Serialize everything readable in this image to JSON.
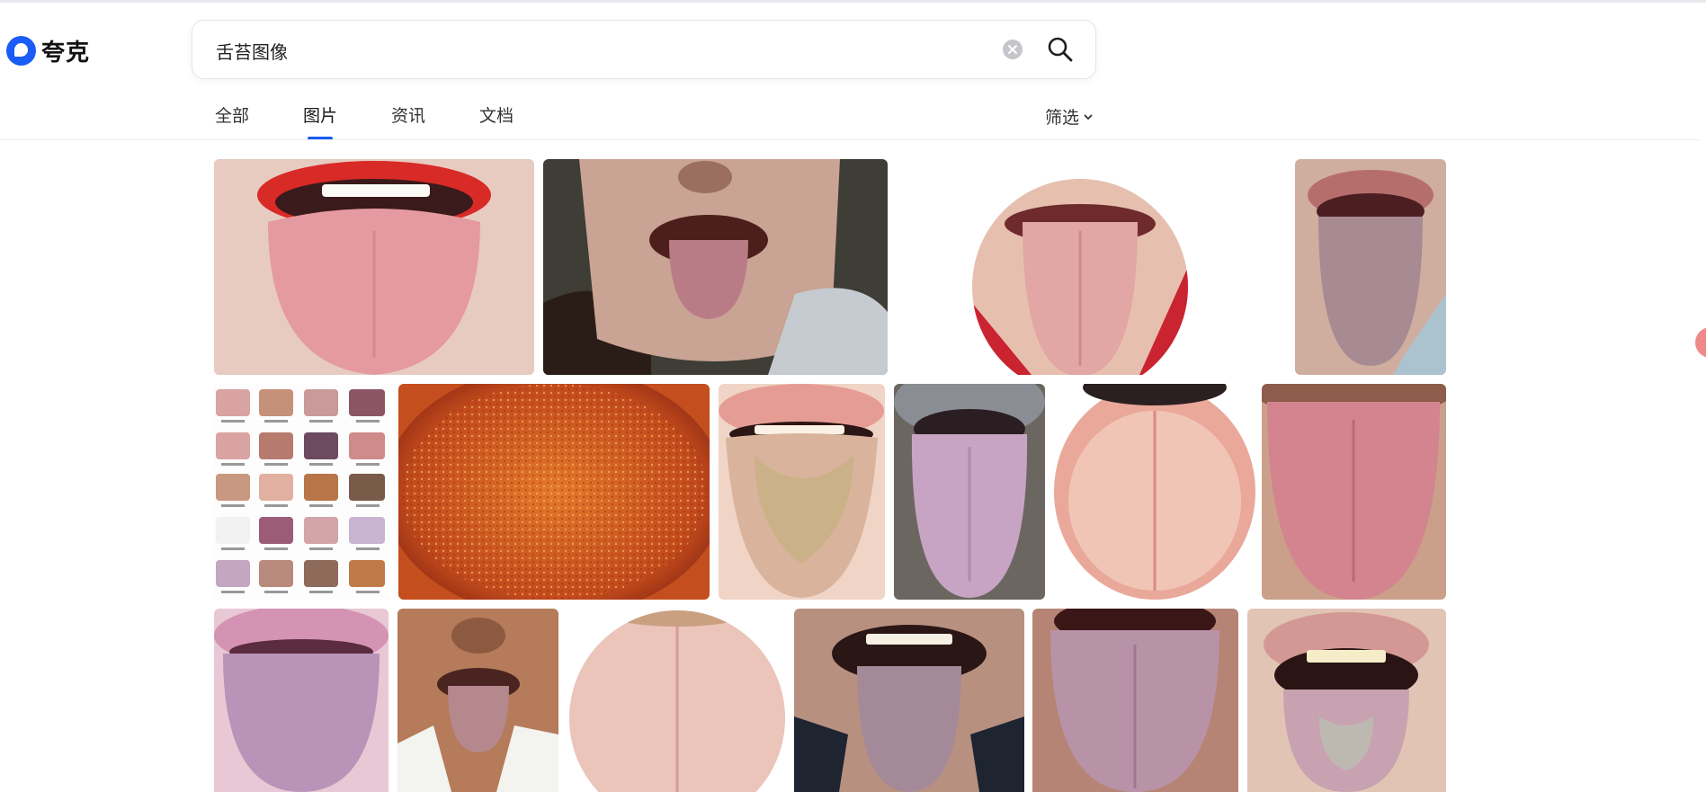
{
  "brand": {
    "name": "夸克",
    "color": "#1a5cf5"
  },
  "search": {
    "query": "舌苔图像",
    "clear_icon": "clear-icon",
    "search_icon": "search-icon"
  },
  "tabs": [
    {
      "label": "全部",
      "active": false
    },
    {
      "label": "图片",
      "active": true
    },
    {
      "label": "资讯",
      "active": false
    },
    {
      "label": "文档",
      "active": false
    }
  ],
  "filter": {
    "label": "筛选",
    "icon": "chevron-down-icon"
  },
  "images": [
    {
      "row": 1,
      "kind": "tongue-photo"
    },
    {
      "row": 1,
      "kind": "tongue-photo"
    },
    {
      "row": 1,
      "kind": "tongue-photo-round"
    },
    {
      "row": 1,
      "kind": "tongue-photo"
    },
    {
      "row": 2,
      "kind": "tongue-chart-grid"
    },
    {
      "row": 2,
      "kind": "tongue-closeup"
    },
    {
      "row": 2,
      "kind": "tongue-photo"
    },
    {
      "row": 2,
      "kind": "tongue-photo"
    },
    {
      "row": 2,
      "kind": "tongue-photo-round"
    },
    {
      "row": 2,
      "kind": "tongue-photo"
    },
    {
      "row": 3,
      "kind": "tongue-photo"
    },
    {
      "row": 3,
      "kind": "tongue-photo"
    },
    {
      "row": 3,
      "kind": "tongue-photo-round"
    },
    {
      "row": 3,
      "kind": "tongue-photo"
    },
    {
      "row": 3,
      "kind": "tongue-photo"
    },
    {
      "row": 3,
      "kind": "tongue-photo"
    }
  ]
}
